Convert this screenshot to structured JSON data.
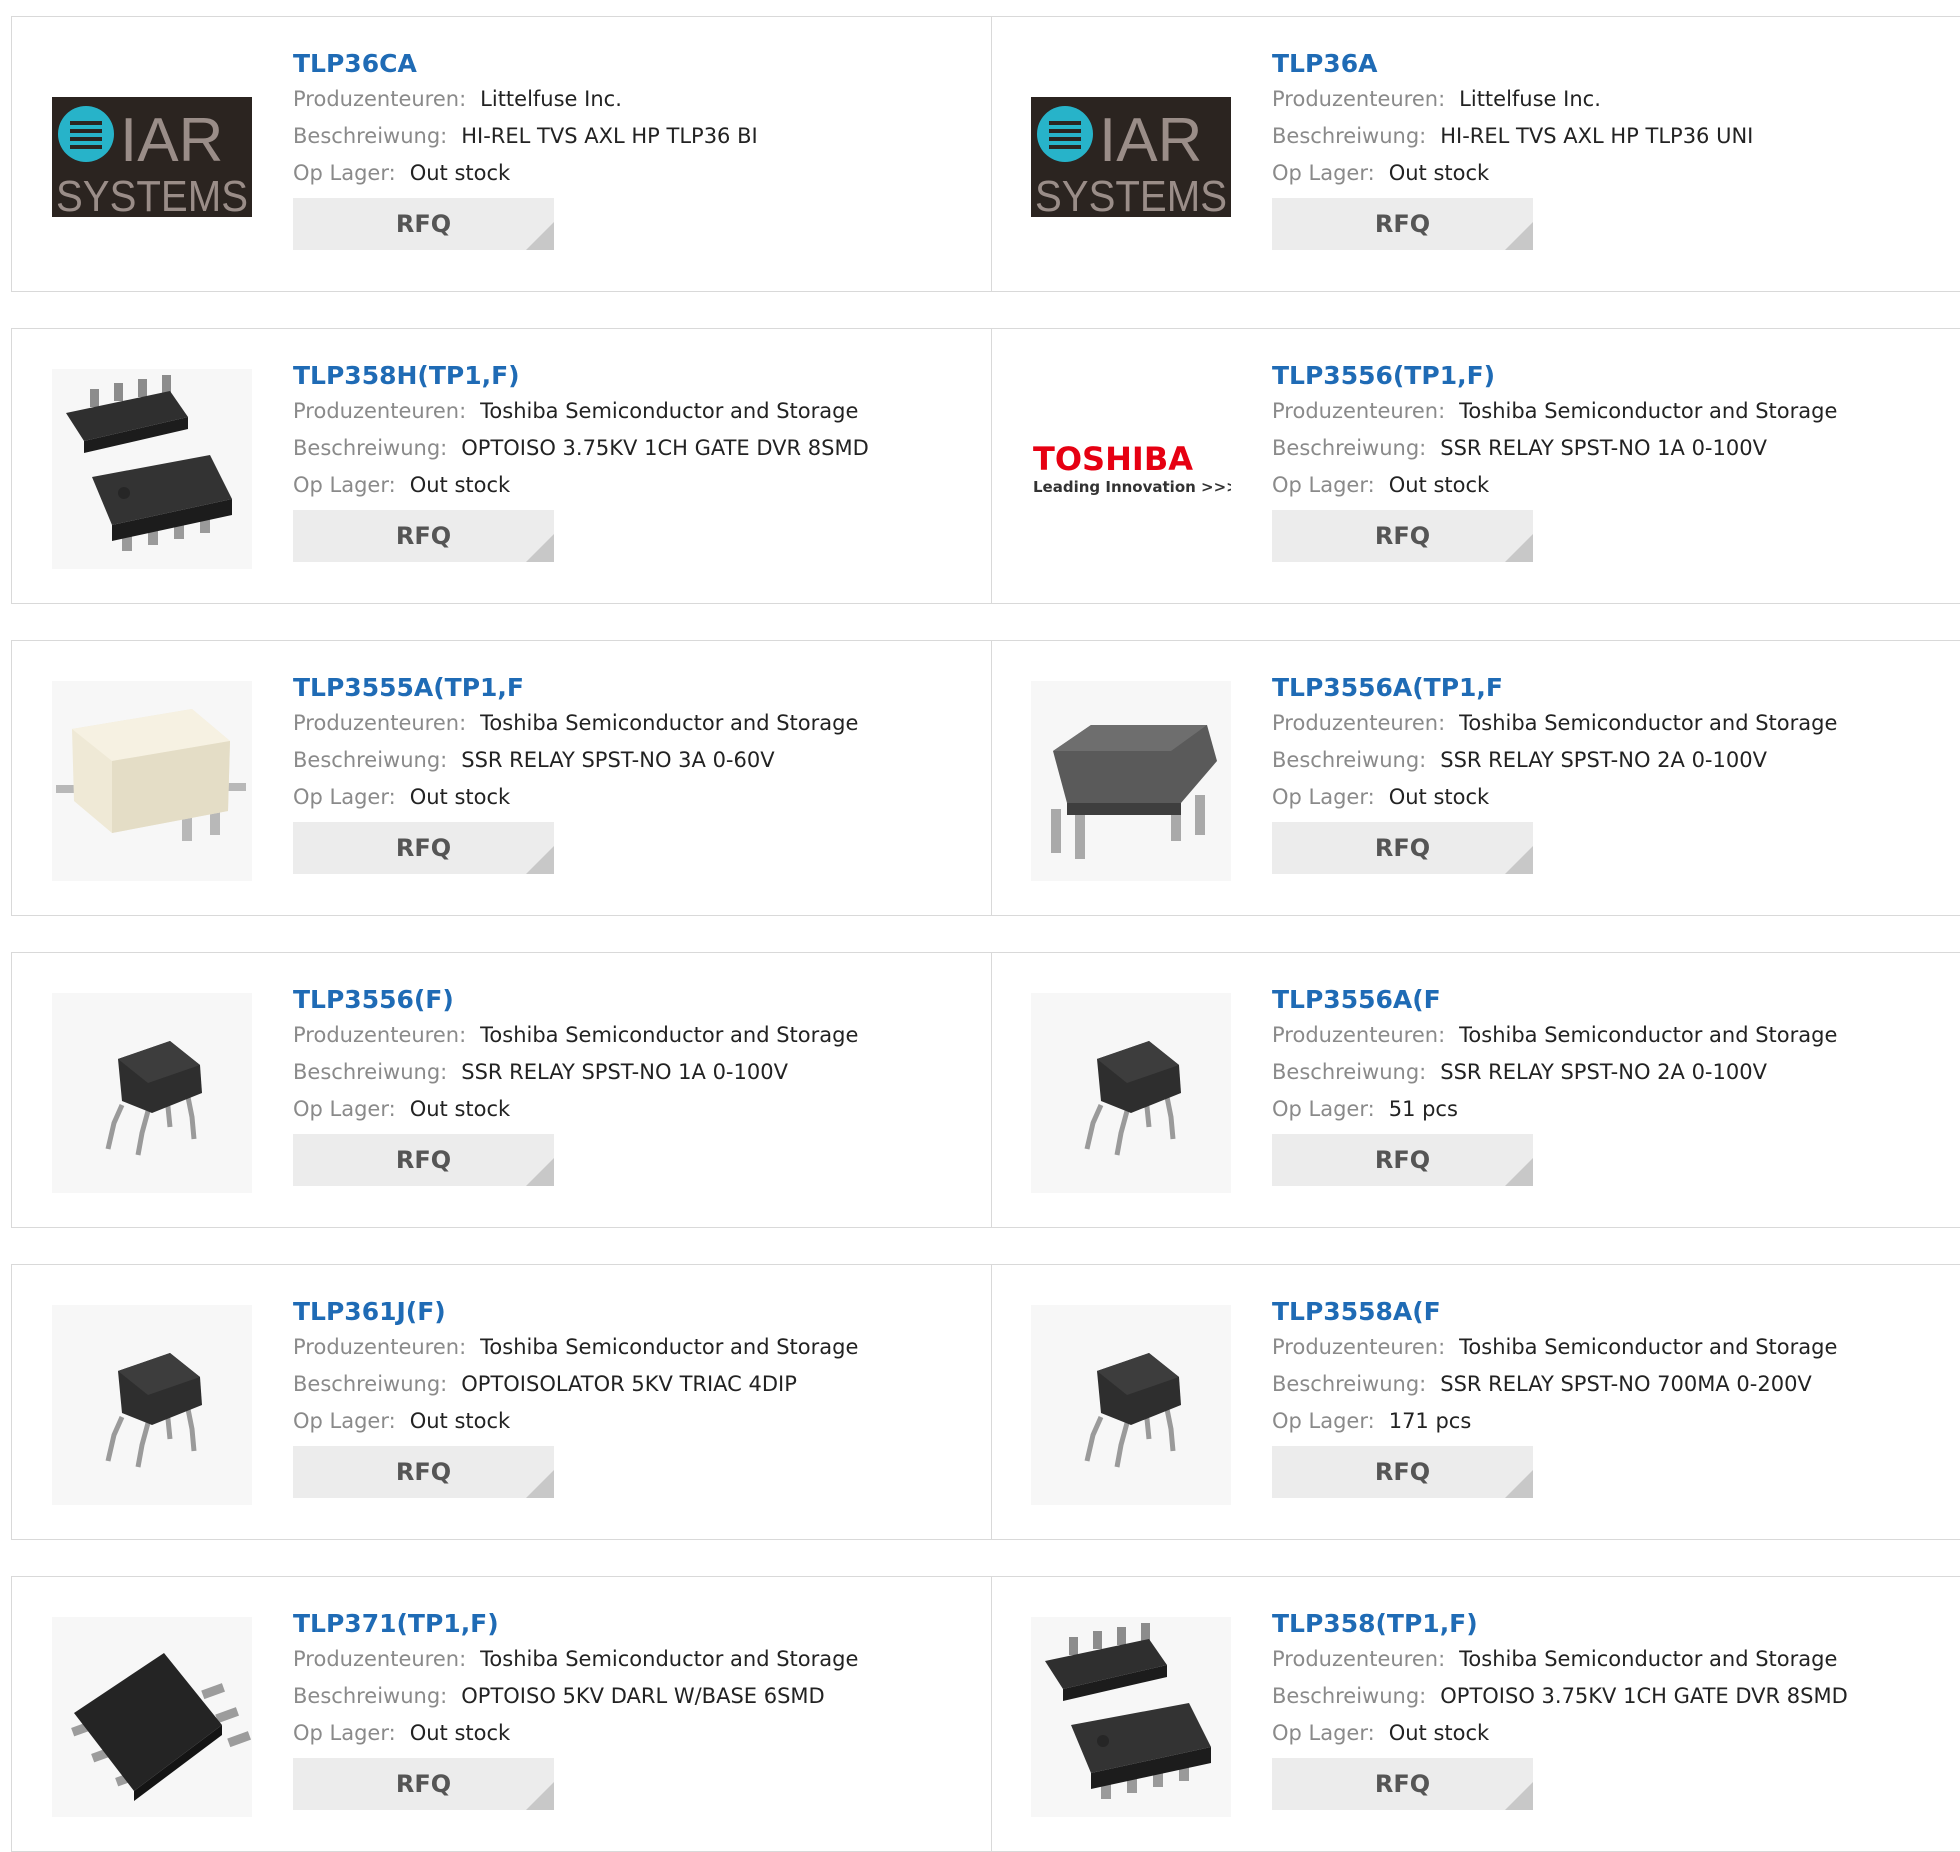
{
  "labels": {
    "manufacturer": "Produzenteuren:",
    "description": "Beschreiwung:",
    "stock": "Op Lager:",
    "rfq": "RFQ"
  },
  "products": [
    {
      "part": "TLP36CA",
      "manufacturer": "Littelfuse Inc.",
      "description": "HI-REL TVS AXL HP TLP36 BI",
      "stock": "Out stock",
      "image": "iar"
    },
    {
      "part": "TLP36A",
      "manufacturer": "Littelfuse Inc.",
      "description": "HI-REL TVS AXL HP TLP36 UNI",
      "stock": "Out stock",
      "image": "iar"
    },
    {
      "part": "TLP358H(TP1,F)",
      "manufacturer": "Toshiba Semiconductor and Storage",
      "description": "OPTOISO 3.75KV 1CH GATE DVR 8SMD",
      "stock": "Out stock",
      "image": "soic8"
    },
    {
      "part": "TLP3556(TP1,F)",
      "manufacturer": "Toshiba Semiconductor and Storage",
      "description": "SSR RELAY SPST-NO 1A 0-100V",
      "stock": "Out stock",
      "image": "toshiba"
    },
    {
      "part": "TLP3555A(TP1,F",
      "manufacturer": "Toshiba Semiconductor and Storage",
      "description": "SSR RELAY SPST-NO 3A 0-60V",
      "stock": "Out stock",
      "image": "white-smd"
    },
    {
      "part": "TLP3556A(TP1,F",
      "manufacturer": "Toshiba Semiconductor and Storage",
      "description": "SSR RELAY SPST-NO 2A 0-100V",
      "stock": "Out stock",
      "image": "gray-smd"
    },
    {
      "part": "TLP3556(F)",
      "manufacturer": "Toshiba Semiconductor and Storage",
      "description": "SSR RELAY SPST-NO 1A 0-100V",
      "stock": "Out stock",
      "image": "dip4"
    },
    {
      "part": "TLP3556A(F",
      "manufacturer": "Toshiba Semiconductor and Storage",
      "description": "SSR RELAY SPST-NO 2A 0-100V",
      "stock": "51 pcs",
      "image": "dip4"
    },
    {
      "part": "TLP361J(F)",
      "manufacturer": "Toshiba Semiconductor and Storage",
      "description": "OPTOISOLATOR 5KV TRIAC 4DIP",
      "stock": "Out stock",
      "image": "dip4"
    },
    {
      "part": "TLP3558A(F",
      "manufacturer": "Toshiba Semiconductor and Storage",
      "description": "SSR RELAY SPST-NO 700MA 0-200V",
      "stock": "171 pcs",
      "image": "dip4"
    },
    {
      "part": "TLP371(TP1,F)",
      "manufacturer": "Toshiba Semiconductor and Storage",
      "description": "OPTOISO 5KV DARL W/BASE 6SMD",
      "stock": "Out stock",
      "image": "smd6"
    },
    {
      "part": "TLP358(TP1,F)",
      "manufacturer": "Toshiba Semiconductor and Storage",
      "description": "OPTOISO 3.75KV 1CH GATE DVR 8SMD",
      "stock": "Out stock",
      "image": "soic8"
    }
  ],
  "logos": {
    "iar": {
      "word1": "IAR",
      "word2": "SYSTEMS"
    },
    "toshiba": {
      "word1": "TOSHIBA",
      "word2": "Leading Innovation >>>"
    }
  },
  "colors": {
    "link": "#1f6bb5",
    "label": "#8a8a8a",
    "rfq_bg": "#ececec",
    "border": "#d9d9d9",
    "toshiba_red": "#e60012",
    "iar_teal": "#27b3c9"
  }
}
